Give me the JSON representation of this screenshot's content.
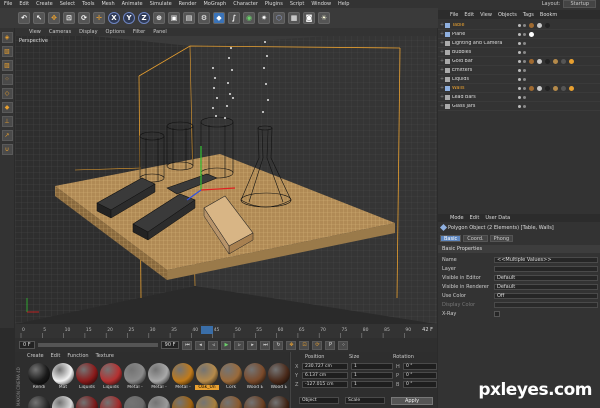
{
  "menubar": {
    "items": [
      "File",
      "Edit",
      "Create",
      "Select",
      "Tools",
      "Mesh",
      "Animate",
      "Simulate",
      "Render",
      "MoGraph",
      "Character",
      "Plugins",
      "Script",
      "Window",
      "Help"
    ],
    "layout_label": "Layout:",
    "layout_value": "Startup"
  },
  "toolbar": {
    "axis_x": "X",
    "axis_y": "Y",
    "axis_z": "Z",
    "icons": [
      "undo-icon",
      "move-icon",
      "scale-icon",
      "rotate-icon",
      "cube-icon",
      "spline-icon",
      "nurbs-icon",
      "array-icon",
      "deformer-icon",
      "scene-icon",
      "camera-icon",
      "light-icon"
    ]
  },
  "viewport": {
    "menu": [
      "View",
      "Cameras",
      "Display",
      "Options",
      "Filter",
      "Panel"
    ],
    "label": "Perspective"
  },
  "timeline": {
    "ticks": [
      "0",
      "5",
      "10",
      "15",
      "20",
      "25",
      "30",
      "35",
      "40",
      "45",
      "50",
      "55",
      "60",
      "65",
      "70",
      "75",
      "80",
      "85",
      "90"
    ],
    "current": "42 F",
    "start_field": "0 F",
    "end_field": "90 F"
  },
  "materials": {
    "menu": [
      "Create",
      "Edit",
      "Function",
      "Texture"
    ],
    "brand": "MAXON CINEMA 4D",
    "row1": [
      {
        "label": "Rendi",
        "color": "#1a1a1a"
      },
      {
        "label": "Mat",
        "color": "#f2f2f2"
      },
      {
        "label": "Liquids",
        "color": "#8a1a1a"
      },
      {
        "label": "Liquids",
        "color": "#b53030"
      },
      {
        "label": "Metal -",
        "color": "#8a8a8a"
      },
      {
        "label": "Metal -",
        "color": "#a8a8a8"
      },
      {
        "label": "Metal -",
        "color": "#c07a1a"
      },
      {
        "label": "Oak_Un",
        "color": "#b58a4a"
      },
      {
        "label": "Cork",
        "color": "#9a6a3a"
      },
      {
        "label": "Wood E",
        "color": "#7a4a2a"
      },
      {
        "label": "Wood E",
        "color": "#4a2a1a"
      }
    ],
    "row2_colors": [
      "#2a2a2a",
      "#d8d8d8",
      "#7a1a1a",
      "#a02a2a",
      "#6a6a6a",
      "#9a9a9a",
      "#a0620f",
      "#a8803e",
      "#8a5a2f",
      "#6a3f22",
      "#3f2415"
    ]
  },
  "coords": {
    "position_header": "Position",
    "size_header": "Size",
    "rotation_header": "Rotation",
    "rows": [
      {
        "axis": "X",
        "pos": "230.727 cm",
        "size": "1",
        "rot_axis": "H",
        "rot": "0 °"
      },
      {
        "axis": "Y",
        "pos": "6.137 cm",
        "size": "1",
        "rot_axis": "P",
        "rot": "0 °"
      },
      {
        "axis": "Z",
        "pos": "-127.015 cm",
        "size": "1",
        "rot_axis": "B",
        "rot": "0 °"
      }
    ],
    "mode1": "Object",
    "mode2": "Scale",
    "apply_label": "Apply"
  },
  "objects": {
    "menu": [
      "File",
      "Edit",
      "View",
      "Objects",
      "Tags",
      "Bookm"
    ],
    "items": [
      {
        "name": "Table",
        "color": "#e8a030",
        "icon_color": "#8fb0e0"
      },
      {
        "name": "Plane",
        "color": "#dddddd",
        "icon_color": "#8fb0e0"
      },
      {
        "name": "Lighting and Camera",
        "color": "#dddddd",
        "icon_color": "#aaaaaa"
      },
      {
        "name": "Bubbles",
        "color": "#dddddd",
        "icon_color": "#aaaaaa"
      },
      {
        "name": "Gold Bar",
        "color": "#dddddd",
        "icon_color": "#aaaaaa"
      },
      {
        "name": "Emitters",
        "color": "#dddddd",
        "icon_color": "#aaaaaa"
      },
      {
        "name": "Liquids",
        "color": "#dddddd",
        "icon_color": "#aaaaaa"
      },
      {
        "name": "Walls",
        "color": "#e8a030",
        "icon_color": "#8fb0e0"
      },
      {
        "name": "Lead Bars",
        "color": "#dddddd",
        "icon_color": "#aaaaaa"
      },
      {
        "name": "Glass Jars",
        "color": "#dddddd",
        "icon_color": "#aaaaaa"
      }
    ]
  },
  "attributes": {
    "menu": [
      "Mode",
      "Edit",
      "User Data"
    ],
    "title": "Polygon Object (2 Elements) [Table, Walls]",
    "tabs": [
      "Basic",
      "Coord.",
      "Phong"
    ],
    "section": "Basic Properties",
    "rows": [
      {
        "label": "Name",
        "value": "<<Multiple Values>>"
      },
      {
        "label": "Layer",
        "value": ""
      },
      {
        "label": "Visible in Editor",
        "value": "Default"
      },
      {
        "label": "Visible in Renderer",
        "value": "Default"
      },
      {
        "label": "Use Color",
        "value": "Off"
      },
      {
        "label": "Display Color",
        "value": ""
      },
      {
        "label": "X-Ray",
        "value": ""
      }
    ]
  },
  "watermark": "pxleyes.com"
}
